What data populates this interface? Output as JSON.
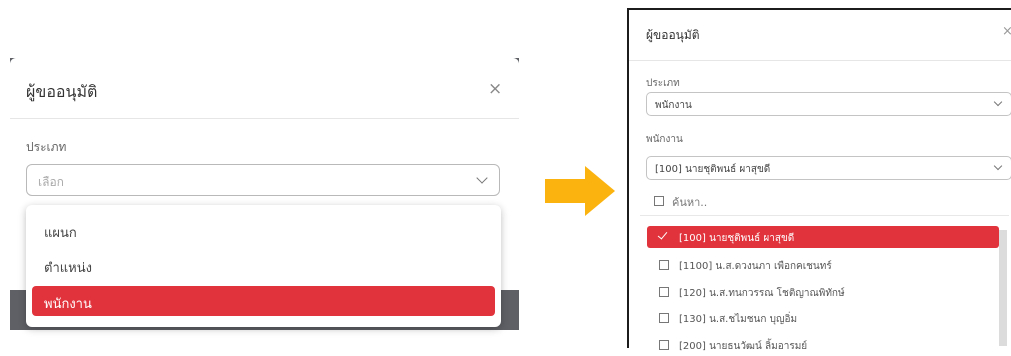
{
  "left": {
    "title": "ผู้ขออนุมัติ",
    "close_icon": "×",
    "type_label": "ประเภท",
    "select_placeholder": "เลือก",
    "options": [
      "แผนก",
      "ตำแหน่ง",
      "พนักงาน"
    ],
    "selected_option": "พนักงาน"
  },
  "right": {
    "title": "ผู้ขออนุมัติ",
    "close_icon": "×",
    "type_label": "ประเภท",
    "type_value": "พนักงาน",
    "employee_label": "พนักงาน",
    "employee_value": "[100] นายชุติพนธ์ ผาสุขดี",
    "search_text": "ค้นหา..",
    "employees": [
      "[100] นายชุติพนธ์ ผาสุขดี",
      "[1100] น.ส.ดวงนภา เพือกคเชนทร์",
      "[120] น.ส.ทนกวรรณ โชติญาณพิทักษ์",
      "[130] น.ส.ชไมชนก บุญอิ่ม",
      "[200] นายธนวัฒน์ ลิ้มอารมย์"
    ]
  },
  "colors": {
    "accent_red": "#e0333c",
    "arrow_yellow": "#fbb30f",
    "overlay_gray": "#5e6066"
  }
}
